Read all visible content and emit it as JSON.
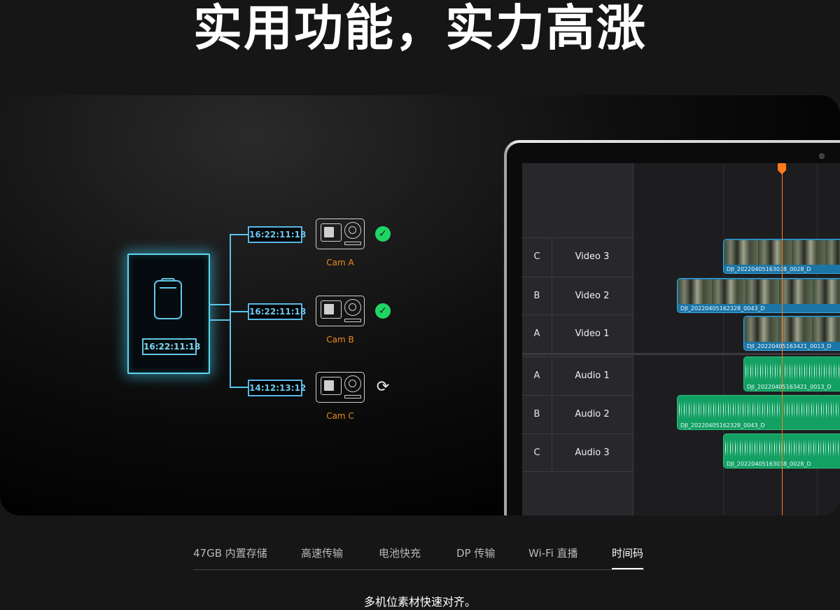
{
  "headline": "实用功能，实力高涨",
  "diagram": {
    "master_timecode": "16:22:11:18",
    "cameras": [
      {
        "label": "Cam A",
        "timecode": "16:22:11:18",
        "status": "synced",
        "status_icon": "check-circle-icon",
        "status_glyph": "✓"
      },
      {
        "label": "Cam B",
        "timecode": "16:22:11:18",
        "status": "synced",
        "status_icon": "check-circle-icon",
        "status_glyph": "✓"
      },
      {
        "label": "Cam C",
        "timecode": "14:12:13:12",
        "status": "syncing",
        "status_icon": "sync-icon",
        "status_glyph": "⟳"
      }
    ],
    "colors": {
      "wire": "#58c4ea",
      "cam_label": "#f08a1c",
      "ok": "#1fd665"
    }
  },
  "editor": {
    "tracks": [
      {
        "id": "C",
        "name": "Video 3",
        "clip": "DJI_20220405163038_0028_D",
        "type": "video"
      },
      {
        "id": "B",
        "name": "Video 2",
        "clip": "DJI_20220405162328_0043_D",
        "type": "video"
      },
      {
        "id": "A",
        "name": "Video 1",
        "clip": "DJI_20220405163421_0013_D",
        "type": "video"
      },
      {
        "id": "A",
        "name": "Audio 1",
        "clip": "DJI_20220405163421_0013_D",
        "type": "audio"
      },
      {
        "id": "B",
        "name": "Audio 2",
        "clip": "DJI_20220405162328_0043_D",
        "type": "audio"
      },
      {
        "id": "C",
        "name": "Audio 3",
        "clip": "DJI_20220405163038_0028_D",
        "type": "audio"
      }
    ],
    "colors": {
      "video_clip": "#1b75a6",
      "audio_clip": "#13a063",
      "playhead": "#ff7a1a"
    }
  },
  "tabs": [
    {
      "label": "47GB 内置存储",
      "active": false
    },
    {
      "label": "高速传输",
      "active": false
    },
    {
      "label": "电池快充",
      "active": false
    },
    {
      "label": "DP 传输",
      "active": false
    },
    {
      "label": "Wi-Fi 直播",
      "active": false
    },
    {
      "label": "时间码",
      "active": true
    }
  ],
  "caption": "多机位素材快速对齐。"
}
